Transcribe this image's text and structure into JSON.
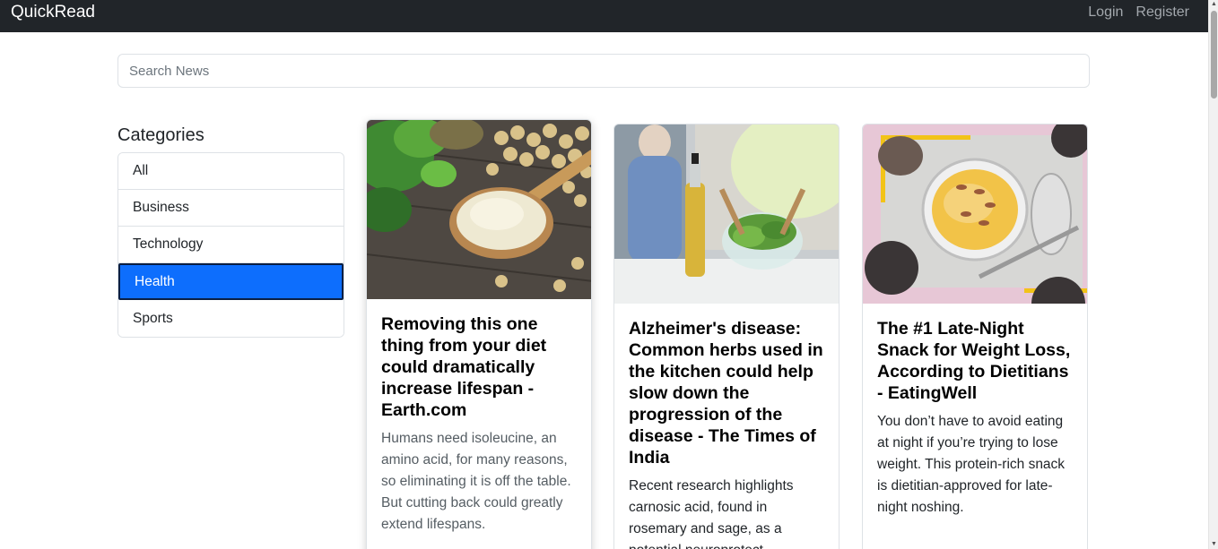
{
  "navbar": {
    "brand": "QuickRead",
    "login": "Login",
    "register": "Register"
  },
  "search": {
    "placeholder": "Search News",
    "value": ""
  },
  "categories": {
    "title": "Categories",
    "items": [
      {
        "label": "All",
        "active": false
      },
      {
        "label": "Business",
        "active": false
      },
      {
        "label": "Technology",
        "active": false
      },
      {
        "label": "Health",
        "active": true
      },
      {
        "label": "Sports",
        "active": false
      }
    ]
  },
  "articles": [
    {
      "title": "Removing this one thing from your diet could dramatically increase lifespan - Earth.com",
      "description": "Humans need isoleucine, an amino acid, for many reasons, so eliminating it is off the table. But cutting back could greatly extend lifespans."
    },
    {
      "title": "Alzheimer's disease: Common herbs used in the kitchen could help slow down the progression of the disease - The Times of India",
      "description": "Recent research highlights carnosic acid, found in rosemary and sage, as a potential neuroprotect"
    },
    {
      "title": "The #1 Late-Night Snack for Weight Loss, According to Dietitians - EatingWell",
      "description": "You don’t have to avoid eating at night if you’re trying to lose weight. This protein-rich snack is dietitian-approved for late-night noshing."
    }
  ],
  "colors": {
    "navbar_bg": "#212529",
    "active_category": "#0d6efd"
  }
}
